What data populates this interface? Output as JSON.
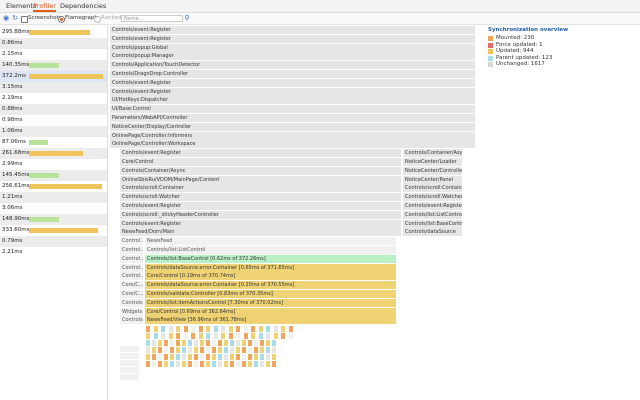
{
  "tabs": [
    "Elements",
    "Profiler",
    "Dependencies"
  ],
  "active_tab": 1,
  "toolbar": {
    "record_icon": "record-icon",
    "reload_icon": "reload-icon",
    "screenshots_label": "Screenshots",
    "flamegraph_label": "Flamegraph",
    "ranked_label": "Ranked",
    "search_placeholder": "Name..."
  },
  "commits": [
    {
      "label": "295.88ms",
      "fill": 0.83,
      "color": "#efc45b"
    },
    {
      "label": "0.86ms",
      "fill": 0,
      "color": "#efc45b"
    },
    {
      "label": "2.15ms",
      "fill": 0,
      "color": "#efc45b"
    },
    {
      "label": "140.35ms",
      "fill": 0.4,
      "color": "#b9e29a"
    },
    {
      "label": "372.2ms",
      "fill": 1.0,
      "color": "#efc45b"
    },
    {
      "label": "3.15ms",
      "fill": 0,
      "color": "#efc45b"
    },
    {
      "label": "2.19ms",
      "fill": 0,
      "color": "#efc45b"
    },
    {
      "label": "0.88ms",
      "fill": 0,
      "color": "#efc45b"
    },
    {
      "label": "0.98ms",
      "fill": 0,
      "color": "#efc45b"
    },
    {
      "label": "1.06ms",
      "fill": 0,
      "color": "#efc45b"
    },
    {
      "label": "87.06ms",
      "fill": 0.25,
      "color": "#b9e29a"
    },
    {
      "label": "261.68ms",
      "fill": 0.73,
      "color": "#efc45b"
    },
    {
      "label": "2.99ms",
      "fill": 0,
      "color": "#efc45b"
    },
    {
      "label": "145.45ms",
      "fill": 0.4,
      "color": "#b9e29a"
    },
    {
      "label": "256.61ms",
      "fill": 0.98,
      "color": "#efc45b"
    },
    {
      "label": "1.21ms",
      "fill": 0,
      "color": "#efc45b"
    },
    {
      "label": "3.06ms",
      "fill": 0,
      "color": "#efc45b"
    },
    {
      "label": "148.90ms",
      "fill": 0.41,
      "color": "#b9e29a"
    },
    {
      "label": "333.60ms",
      "fill": 0.93,
      "color": "#efc45b"
    },
    {
      "label": "0.79ms",
      "fill": 0,
      "color": "#efc45b"
    },
    {
      "label": "2.21ms",
      "fill": 0,
      "color": "#efc45b"
    }
  ],
  "selected_commit": 4,
  "flame_rows": [
    [
      {
        "t": "Controls/event:Register",
        "c": "g"
      }
    ],
    [
      {
        "t": "Controls/event:Register",
        "c": "g"
      }
    ],
    [
      {
        "t": "Controls/popup:Global",
        "c": "g"
      }
    ],
    [
      {
        "t": "Controls/popup:Manager",
        "c": "g"
      }
    ],
    [
      {
        "t": "Controls/Application/TouchDetector",
        "c": "g"
      }
    ],
    [
      {
        "t": "Controls/DragnDrop:Controller",
        "c": "g"
      }
    ],
    [
      {
        "t": "Controls/event:Register",
        "c": "g"
      }
    ],
    [
      {
        "t": "Controls/event:Register",
        "c": "g"
      }
    ],
    [
      {
        "t": "UI/HotKeys:Dispatcher",
        "c": "g"
      }
    ],
    [
      {
        "t": "UI/Base:Control",
        "c": "g"
      }
    ],
    [
      {
        "t": "Parameters/WebAPI/Controller",
        "c": "g"
      }
    ],
    [
      {
        "t": "NoticeCenter/Display/Controller",
        "c": "g"
      }
    ],
    [
      {
        "t": "OnlinePage/Controller:Informers",
        "c": "g"
      }
    ],
    [
      {
        "t": "OnlinePage/Controller:Workspace",
        "c": "g"
      }
    ],
    [
      {
        "t": "Controls/event:Register",
        "c": "g"
      },
      {
        "t": "Controls/Container/Async",
        "c": "g"
      }
    ],
    [
      {
        "t": "Core/Control",
        "c": "g"
      },
      {
        "t": "NoticeCenter/Loader",
        "c": "g"
      }
    ],
    [
      {
        "t": "Controls/Container/Async",
        "c": "g"
      },
      {
        "t": "NoticeCenter/Controller",
        "c": "g"
      }
    ],
    [
      {
        "t": "OnlineSbisRu/VDOM/MainPage/Content",
        "c": "g"
      },
      {
        "t": "NoticeCenter/Panel",
        "c": "g"
      }
    ],
    [
      {
        "t": "Controls/scroll:Container",
        "c": "g"
      },
      {
        "t": "Controls/scroll:Container",
        "c": "g"
      }
    ],
    [
      {
        "t": "Controls/scroll:Watcher",
        "c": "g"
      },
      {
        "t": "Controls/scroll:Watcher",
        "c": "g"
      }
    ],
    [
      {
        "t": "Controls/event:Register",
        "c": "g"
      },
      {
        "t": "Controls/event:Register",
        "c": "g"
      }
    ],
    [
      {
        "t": "Controls/scroll:_stickyHeaderController",
        "c": "g"
      },
      {
        "t": "Controls/list:ListControl",
        "c": "g"
      }
    ],
    [
      {
        "t": "Controls/event:Register",
        "c": "g"
      },
      {
        "t": "Controls/list:BaseControl",
        "c": "g"
      }
    ],
    [
      {
        "t": "NewsFeed/Dom/Main",
        "c": "g"
      },
      {
        "t": "Controls/dataSource",
        "c": "g"
      }
    ],
    [
      {
        "t": "Control...",
        "c": "g2"
      },
      {
        "t": "NewsFeed",
        "c": "g2"
      }
    ],
    [
      {
        "t": "Control...",
        "c": "g2"
      },
      {
        "t": "Controls/list:ListControl",
        "c": "g2"
      }
    ],
    [
      {
        "t": "Control...",
        "c": "g2"
      },
      {
        "t": "Controls/list:BaseControl [0.62ms of 372.26ms]",
        "c": "gn"
      }
    ],
    [
      {
        "t": "Control...",
        "c": "g2"
      },
      {
        "t": "Controls/dataSource:error.Container [0.65ms of 371.65ms]",
        "c": "y"
      }
    ],
    [
      {
        "t": "Control...",
        "c": "g2"
      },
      {
        "t": "Core/Control [0.19ms of 370.74ms]",
        "c": "y"
      }
    ],
    [
      {
        "t": "Core/C...",
        "c": "g2"
      },
      {
        "t": "Controls/dataSource:error.Container [0.20ms of 370.55ms]",
        "c": "y"
      }
    ],
    [
      {
        "t": "Core/C...",
        "c": "g2"
      },
      {
        "t": "Controls/validate:Controller [0.83ms of 370.35ms]",
        "c": "y"
      }
    ],
    [
      {
        "t": "Controls/...",
        "c": "g2"
      },
      {
        "t": "Controls/list:itemActionsControl [7.30ms of 370.02ms]",
        "c": "y"
      }
    ],
    [
      {
        "t": "Widgets...",
        "c": "g2"
      },
      {
        "t": "Core/Control [0.69ms of 362.64ms]",
        "c": "y"
      }
    ],
    [
      {
        "t": "Controls/...",
        "c": "g2"
      },
      {
        "t": "NewsFeed/View [36.96ms of 361.78ms]",
        "c": "y"
      }
    ]
  ],
  "legend": {
    "title": "Synchronization overview",
    "items": [
      {
        "label": "Mounted: 230",
        "color": "#f0a55c"
      },
      {
        "label": "Force updated: 1",
        "color": "#e26b6b"
      },
      {
        "label": "Updated: 944",
        "color": "#efc45b"
      },
      {
        "label": "Parent updated: 123",
        "color": "#a7ddea"
      },
      {
        "label": "Unchanged: 1617",
        "color": "#d6d6d6"
      }
    ]
  }
}
